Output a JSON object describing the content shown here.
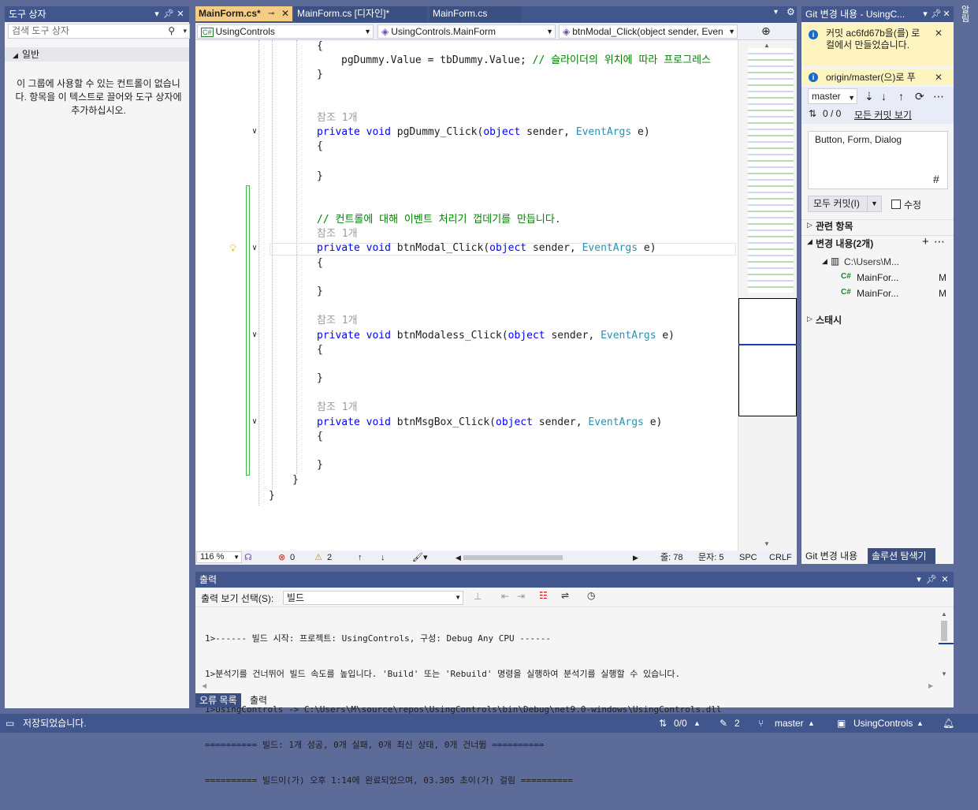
{
  "toolbox": {
    "title": "도구 상자",
    "search_placeholder": "검색 도구 상자",
    "group": "일반",
    "empty_message": "이 그룹에 사용할 수 있는 컨트롤이 없습니다. 항목을 이 텍스트로 끌어와 도구 상자에 추가하십시오."
  },
  "tabs": [
    {
      "label": "MainForm.cs*",
      "active": true
    },
    {
      "label": "MainForm.cs [디자인]*",
      "active": false
    },
    {
      "label": "MainForm.cs",
      "active": false
    }
  ],
  "nav": {
    "project": "UsingControls",
    "type": "UsingControls.MainForm",
    "member": "btnModal_Click(object sender, Even"
  },
  "code": {
    "open_brace": "{",
    "dummy_line_a": "pgDummy.Value = tbDummy.Value; ",
    "dummy_comment": "// 슬라이더의 위치에 따라 프로그레스",
    "close_brace": "}",
    "ref": "참조 1개",
    "comment": "// 컨트롤에 대해 이벤트 처리기 껍데기를 만듭니다.",
    "methods": [
      "pgDummy_Click",
      "btnModal_Click",
      "btnModaless_Click",
      "btnMsgBox_Click"
    ],
    "kw_private": "private",
    "kw_void": "void",
    "kw_object": "object",
    "p_sender": " sender, ",
    "t_eventargs": "EventArgs",
    "p_e": " e)"
  },
  "editor_status": {
    "zoom": "116 %",
    "errors": "0",
    "warnings": "2",
    "line": "줄: 78",
    "col": "문자: 5",
    "spc": "SPC",
    "crlf": "CRLF"
  },
  "git": {
    "title": "Git 변경 내용 - UsingC...",
    "info1": "커밋 ac6fd67b을(를) 로컬에서 만들었습니다.",
    "info2": "origin/master(으)로 푸",
    "branch": "master",
    "counts": "0 / 0",
    "all_commits": "모든 커밋 보기",
    "commit_message": "Button, Form, Dialog",
    "commit_all": "모두 커밋(I)",
    "amend": "수정",
    "related": "관련 항목",
    "changes": "변경 내용(2개)",
    "folder": "C:\\Users\\M...",
    "files": [
      {
        "name": "MainFor...",
        "status": "M"
      },
      {
        "name": "MainFor...",
        "status": "M"
      }
    ],
    "stash": "스태시",
    "tab_git": "Git 변경 내용",
    "tab_solution": "솔루션 탐색기"
  },
  "output": {
    "title": "출력",
    "source_label": "출력 보기 선택(S):",
    "source_value": "빌드",
    "lines": [
      "1>------ 빌드 시작: 프로젝트: UsingControls, 구성: Debug Any CPU ------",
      "1>분석기를 건너뛰어 빌드 속도를 높입니다. 'Build' 또는 'Rebuild' 명령을 실행하여 분석기를 실행할 수 있습니다.",
      "1>UsingControls -> C:\\Users\\M\\source\\repos\\UsingControls\\bin\\Debug\\net9.0-windows\\UsingControls.dll",
      "========== 빌드: 1개 성공, 0개 실패, 0개 최신 상태, 0개 건너뜀 ==========",
      "========== 빌드이(가) 오후 1:14에 완료되었으며, 03.305 초이(가) 걸림 =========="
    ],
    "tab_errors": "오류 목록",
    "tab_output": "출력"
  },
  "statusbar": {
    "saved": "저장되었습니다.",
    "sync": "0/0",
    "edits": "2",
    "branch": "master",
    "repo": "UsingControls"
  },
  "right_edge": "알림"
}
